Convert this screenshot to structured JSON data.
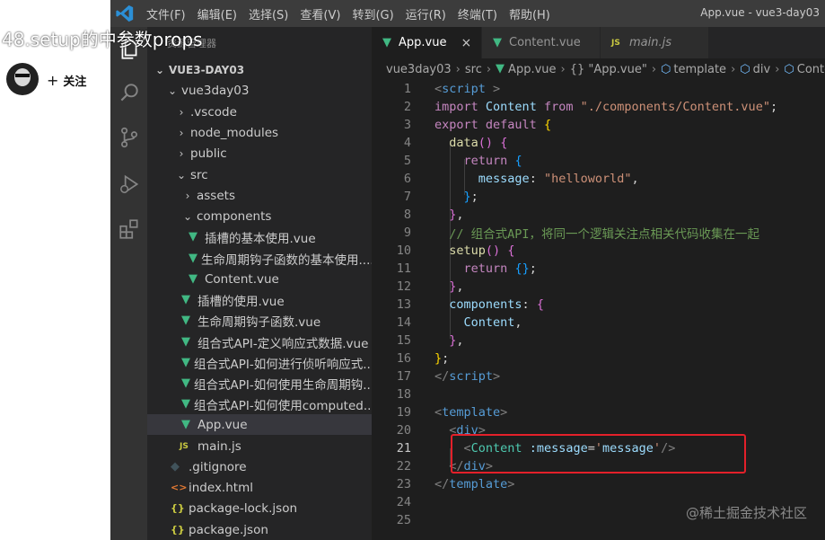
{
  "overlay": {
    "video_title": "48.setup的中参数props",
    "follow_label": "关注"
  },
  "titlebar": {
    "menu": [
      "文件(F)",
      "编辑(E)",
      "选择(S)",
      "查看(V)",
      "转到(G)",
      "运行(R)",
      "终端(T)",
      "帮助(H)"
    ],
    "window_title": "App.vue - vue3-day03"
  },
  "sidebar": {
    "header": "资源管理器",
    "root": "VUE3-DAY03",
    "items": [
      {
        "label": "vue3day03",
        "type": "folder-open"
      },
      {
        "label": ".vscode",
        "type": "folder"
      },
      {
        "label": "node_modules",
        "type": "folder"
      },
      {
        "label": "public",
        "type": "folder"
      },
      {
        "label": "src",
        "type": "folder-open"
      },
      {
        "label": "assets",
        "type": "folder"
      },
      {
        "label": "components",
        "type": "folder-open"
      },
      {
        "label": "插槽的基本使用.vue",
        "type": "vue"
      },
      {
        "label": "生命周期钩子函数的基本使用....",
        "type": "vue"
      },
      {
        "label": "Content.vue",
        "type": "vue"
      },
      {
        "label": "插槽的使用.vue",
        "type": "vue"
      },
      {
        "label": "生命周期钩子函数.vue",
        "type": "vue"
      },
      {
        "label": "组合式API-定义响应式数据.vue",
        "type": "vue"
      },
      {
        "label": "组合式API-如何进行侦听响应式...",
        "type": "vue"
      },
      {
        "label": "组合式API-如何使用生命周期钩...",
        "type": "vue"
      },
      {
        "label": "组合式API-如何使用computed....",
        "type": "vue"
      },
      {
        "label": "App.vue",
        "type": "vue"
      },
      {
        "label": "main.js",
        "type": "js"
      },
      {
        "label": ".gitignore",
        "type": "git"
      },
      {
        "label": "index.html",
        "type": "html"
      },
      {
        "label": "package-lock.json",
        "type": "json"
      },
      {
        "label": "package.json",
        "type": "json"
      }
    ]
  },
  "tabs": [
    {
      "label": "App.vue",
      "close": "×"
    },
    {
      "label": "Content.vue"
    },
    {
      "label": "main.js"
    }
  ],
  "breadcrumb": [
    "vue3day03",
    "src",
    "App.vue",
    "{} \"App.vue\"",
    "template",
    "div",
    "Conte"
  ],
  "editor": {
    "line_numbers": [
      "1",
      "2",
      "3",
      "4",
      "5",
      "6",
      "7",
      "8",
      "9",
      "10",
      "11",
      "12",
      "13",
      "14",
      "15",
      "16",
      "17",
      "18",
      "19",
      "20",
      "21",
      "22",
      "23",
      "24",
      "25"
    ],
    "current_line": "21"
  },
  "watermark": "@稀土掘金技术社区",
  "colors": {
    "highlight_box": "#e3202a",
    "vue_icon": "#41b883",
    "editor_bg": "#1e1e1e"
  }
}
